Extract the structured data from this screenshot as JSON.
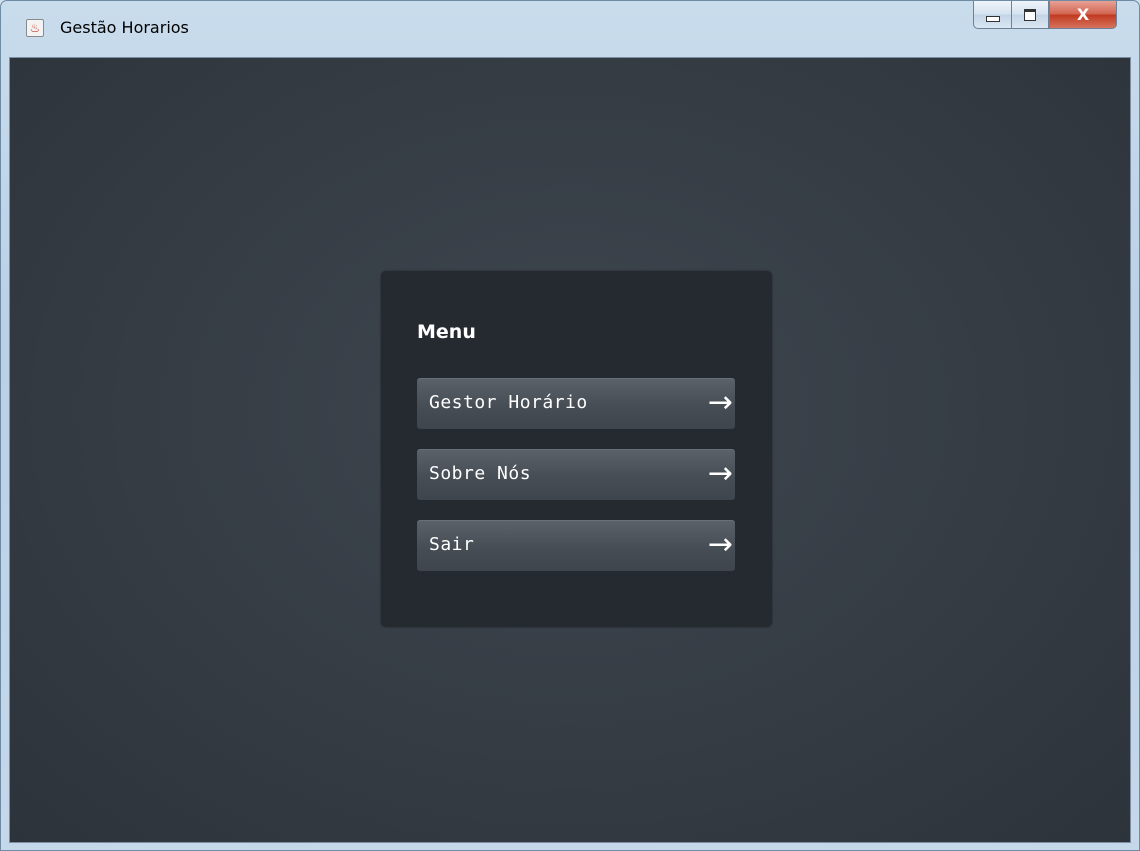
{
  "window": {
    "title": "Gestão Horarios",
    "icon": "java-icon",
    "controls": {
      "minimize": "minimize-icon",
      "maximize": "maximize-icon",
      "close": "close-icon",
      "close_glyph": "X"
    }
  },
  "menu": {
    "title": "Menu",
    "items": [
      {
        "label": "Gestor Horário",
        "icon": "arrow-right-icon",
        "arrow": "→"
      },
      {
        "label": "Sobre Nós",
        "icon": "arrow-right-icon",
        "arrow": "→"
      },
      {
        "label": "Sair",
        "icon": "arrow-right-icon",
        "arrow": "→"
      }
    ]
  },
  "colors": {
    "background": "#353c44",
    "panel": "#252a31",
    "button": "#4b5159",
    "text": "#ffffff",
    "close_button": "#c9462c"
  }
}
